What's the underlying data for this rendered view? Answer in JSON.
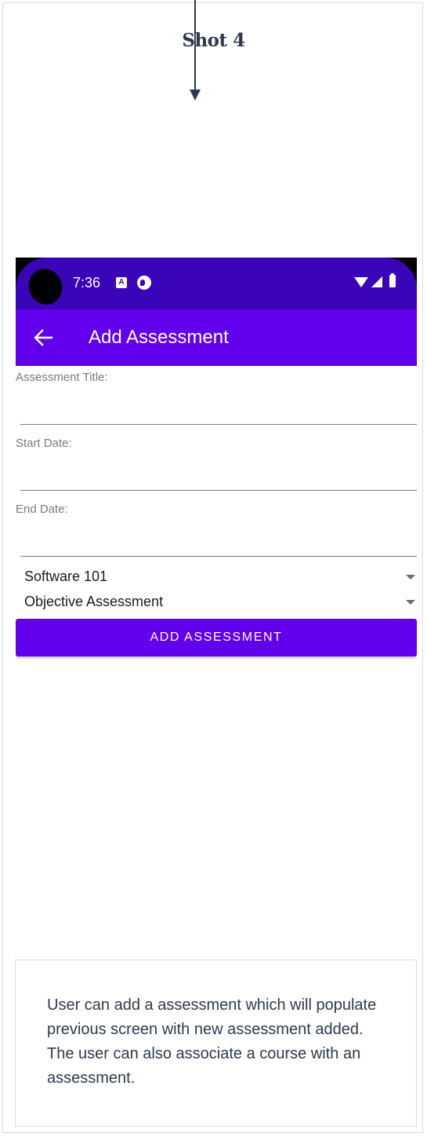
{
  "annotation": {
    "shot_title": "Shot 4",
    "description": "User can add a assessment which will populate previous screen with new assessment added. The user can also associate a course with an assessment."
  },
  "status_bar": {
    "time": "7:36",
    "notification_icons": [
      "a-icon",
      "pocket-casts-icon"
    ],
    "system_icons": [
      "wifi-icon",
      "signal-icon",
      "battery-icon"
    ]
  },
  "app_bar": {
    "title": "Add Assessment",
    "back_icon": "arrow-left-icon"
  },
  "form": {
    "title_label": "Assessment Title:",
    "title_value": "",
    "start_label": "Start Date:",
    "start_value": "",
    "end_label": "End Date:",
    "end_value": "",
    "course_spinner": "Software 101",
    "type_spinner": "Objective Assessment",
    "submit_label": "ADD ASSESSMENT"
  },
  "colors": {
    "status_bar": "#3a04b8",
    "app_bar": "#6200ee",
    "button": "#6200ee",
    "annotation_text": "#2f3a49"
  }
}
